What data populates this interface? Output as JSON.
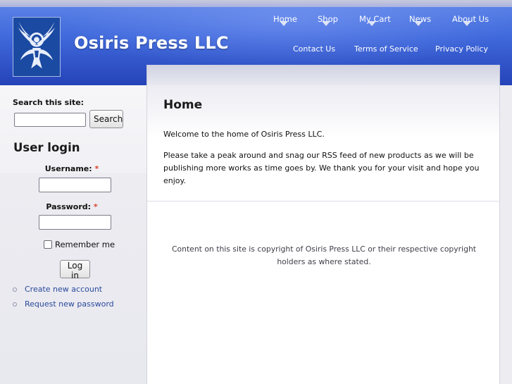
{
  "site": {
    "name": "Osiris Press LLC",
    "logo_icon": "winged-ankh-logo-icon"
  },
  "primary_nav": [
    {
      "label": "Home"
    },
    {
      "label": "Shop"
    },
    {
      "label": "My Cart"
    },
    {
      "label": "News"
    },
    {
      "label": "About Us"
    }
  ],
  "secondary_nav": [
    {
      "label": "Contact Us"
    },
    {
      "label": "Terms of Service"
    },
    {
      "label": "Privacy Policy"
    }
  ],
  "search": {
    "label": "Search this site:",
    "value": "",
    "button_label": "Search"
  },
  "login": {
    "title": "User login",
    "username_label": "Username:",
    "username_value": "",
    "password_label": "Password:",
    "password_value": "",
    "required_marker": "*",
    "remember_label": "Remember me",
    "remember_checked": false,
    "button_label": "Log in",
    "links": [
      {
        "label": "Create new account"
      },
      {
        "label": "Request new password"
      }
    ]
  },
  "main": {
    "title": "Home",
    "paragraphs": [
      "Welcome to the home of Osiris Press LLC.",
      "Please take a peak around and snag our RSS feed of new products as we will be publishing more works as time goes by. We thank you for your visit and hope you enjoy."
    ],
    "footer": "Content on this site is copyright of Osiris Press LLC or their respective copyright holders as where stated."
  },
  "colors": {
    "header_top": "#5f86e8",
    "header_bottom": "#2543b8",
    "link": "#2b4a9c",
    "required": "#d9442b"
  }
}
